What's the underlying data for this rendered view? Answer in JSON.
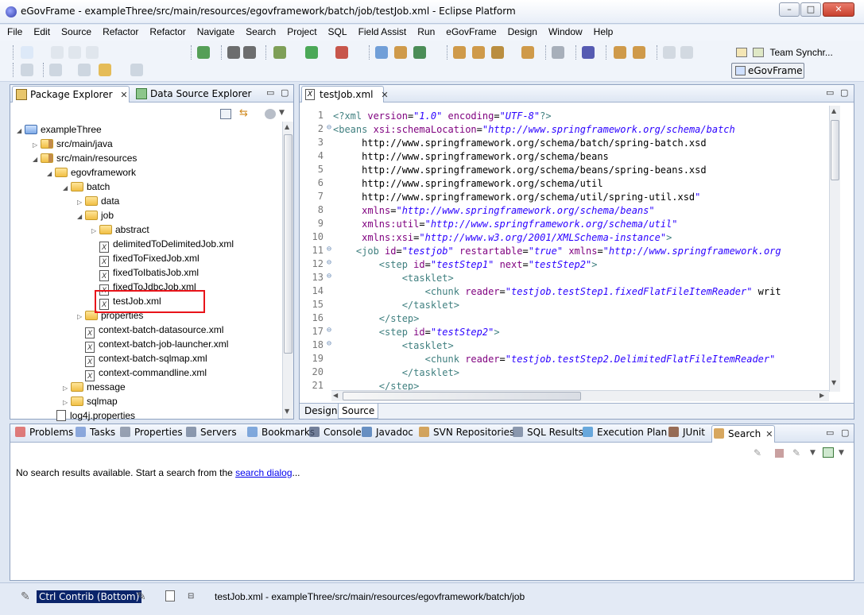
{
  "window": {
    "title": "eGovFrame - exampleThree/src/main/resources/egovframework/batch/job/testJob.xml - Eclipse Platform",
    "controls": {
      "minimize": "–",
      "maximize": "□",
      "close": "✕"
    }
  },
  "menu": [
    "File",
    "Edit",
    "Source",
    "Refactor",
    "Refactor",
    "Navigate",
    "Search",
    "Project",
    "SQL",
    "Field Assist",
    "Run",
    "eGovFrame",
    "Design",
    "Window",
    "Help"
  ],
  "perspectives": {
    "team": "Team Synchr...",
    "active": "eGovFrame"
  },
  "explorer": {
    "tabs": [
      {
        "label": "Package Explorer",
        "close": "✕"
      },
      {
        "label": "Data Source Explorer"
      }
    ],
    "tree": [
      {
        "label": "exampleThree",
        "kind": "project",
        "twisty": "◢"
      },
      {
        "label": "src/main/java",
        "kind": "pkg",
        "twisty": "▷"
      },
      {
        "label": "src/main/resources",
        "kind": "pkg",
        "twisty": "◢"
      },
      {
        "label": "egovframework",
        "kind": "folder",
        "twisty": "◢"
      },
      {
        "label": "batch",
        "kind": "folder",
        "twisty": "◢"
      },
      {
        "label": "data",
        "kind": "folder",
        "twisty": "▷"
      },
      {
        "label": "job",
        "kind": "folder",
        "twisty": "◢"
      },
      {
        "label": "abstract",
        "kind": "folder",
        "twisty": "▷"
      },
      {
        "label": "delimitedToDelimitedJob.xml",
        "kind": "xml",
        "twisty": ""
      },
      {
        "label": "fixedToFixedJob.xml",
        "kind": "xml",
        "twisty": ""
      },
      {
        "label": "fixedToIbatisJob.xml",
        "kind": "xml",
        "twisty": ""
      },
      {
        "label": "fixedToJdbcJob.xml",
        "kind": "xml",
        "twisty": ""
      },
      {
        "label": "testJob.xml",
        "kind": "xml",
        "twisty": ""
      },
      {
        "label": "properties",
        "kind": "folder",
        "twisty": "▷"
      },
      {
        "label": "context-batch-datasource.xml",
        "kind": "xml",
        "twisty": ""
      },
      {
        "label": "context-batch-job-launcher.xml",
        "kind": "xml",
        "twisty": ""
      },
      {
        "label": "context-batch-sqlmap.xml",
        "kind": "xml",
        "twisty": ""
      },
      {
        "label": "context-commandline.xml",
        "kind": "xml",
        "twisty": ""
      },
      {
        "label": "message",
        "kind": "folder",
        "twisty": "▷"
      },
      {
        "label": "sqlmap",
        "kind": "folder",
        "twisty": "▷"
      },
      {
        "label": "log4j.properties",
        "kind": "file",
        "twisty": ""
      }
    ],
    "highlight_color": "#e8141a"
  },
  "editor": {
    "tab": {
      "label": "testJob.xml",
      "close": "✕"
    },
    "bottom_tabs": [
      "Design",
      "Source"
    ],
    "lines": [
      {
        "n": "1",
        "fold": "",
        "code": "<?xml version=\"1.0\" encoding=\"UTF-8\"?>"
      },
      {
        "n": "2",
        "fold": "⊖",
        "code": "<beans xsi:schemaLocation=\"http://www.springframework.org/schema/batch"
      },
      {
        "n": "3",
        "fold": "",
        "code": "     http://www.springframework.org/schema/batch/spring-batch.xsd"
      },
      {
        "n": "4",
        "fold": "",
        "code": "     http://www.springframework.org/schema/beans"
      },
      {
        "n": "5",
        "fold": "",
        "code": "     http://www.springframework.org/schema/beans/spring-beans.xsd"
      },
      {
        "n": "6",
        "fold": "",
        "code": "     http://www.springframework.org/schema/util"
      },
      {
        "n": "7",
        "fold": "",
        "code": "     http://www.springframework.org/schema/util/spring-util.xsd\""
      },
      {
        "n": "8",
        "fold": "",
        "code": "     xmlns=\"http://www.springframework.org/schema/beans\""
      },
      {
        "n": "9",
        "fold": "",
        "code": "     xmlns:util=\"http://www.springframework.org/schema/util\""
      },
      {
        "n": "10",
        "fold": "",
        "code": "     xmlns:xsi=\"http://www.w3.org/2001/XMLSchema-instance\">"
      },
      {
        "n": "11",
        "fold": "⊖",
        "code": "    <job id=\"testjob\" restartable=\"true\" xmlns=\"http://www.springframework.org"
      },
      {
        "n": "12",
        "fold": "⊖",
        "code": "        <step id=\"testStep1\" next=\"testStep2\">"
      },
      {
        "n": "13",
        "fold": "⊖",
        "code": "            <tasklet>"
      },
      {
        "n": "14",
        "fold": "",
        "code": "                <chunk reader=\"testjob.testStep1.fixedFlatFileItemReader\" writ"
      },
      {
        "n": "15",
        "fold": "",
        "code": "            </tasklet>"
      },
      {
        "n": "16",
        "fold": "",
        "code": "        </step>"
      },
      {
        "n": "17",
        "fold": "⊖",
        "code": "        <step id=\"testStep2\">"
      },
      {
        "n": "18",
        "fold": "⊖",
        "code": "            <tasklet>"
      },
      {
        "n": "19",
        "fold": "",
        "code": "                <chunk reader=\"testjob.testStep2.DelimitedFlatFileItemReader\""
      },
      {
        "n": "20",
        "fold": "",
        "code": "            </tasklet>"
      },
      {
        "n": "21",
        "fold": "",
        "code": "        </step>"
      }
    ]
  },
  "bottom": {
    "tabs": [
      "Problems",
      "Tasks",
      "Properties",
      "Servers",
      "Bookmarks",
      "Console",
      "Javadoc",
      "SVN Repositories",
      "SQL Results",
      "Execution Plan",
      "JUnit",
      "Search"
    ],
    "active_close": "✕",
    "message": "No search results available. Start a search from the ",
    "link": "search dialog",
    "ellipsis": "..."
  },
  "status": {
    "ctrl_contrib": "Ctrl Contrib (Bottom)",
    "path": "testJob.xml - exampleThree/src/main/resources/egovframework/batch/job"
  }
}
